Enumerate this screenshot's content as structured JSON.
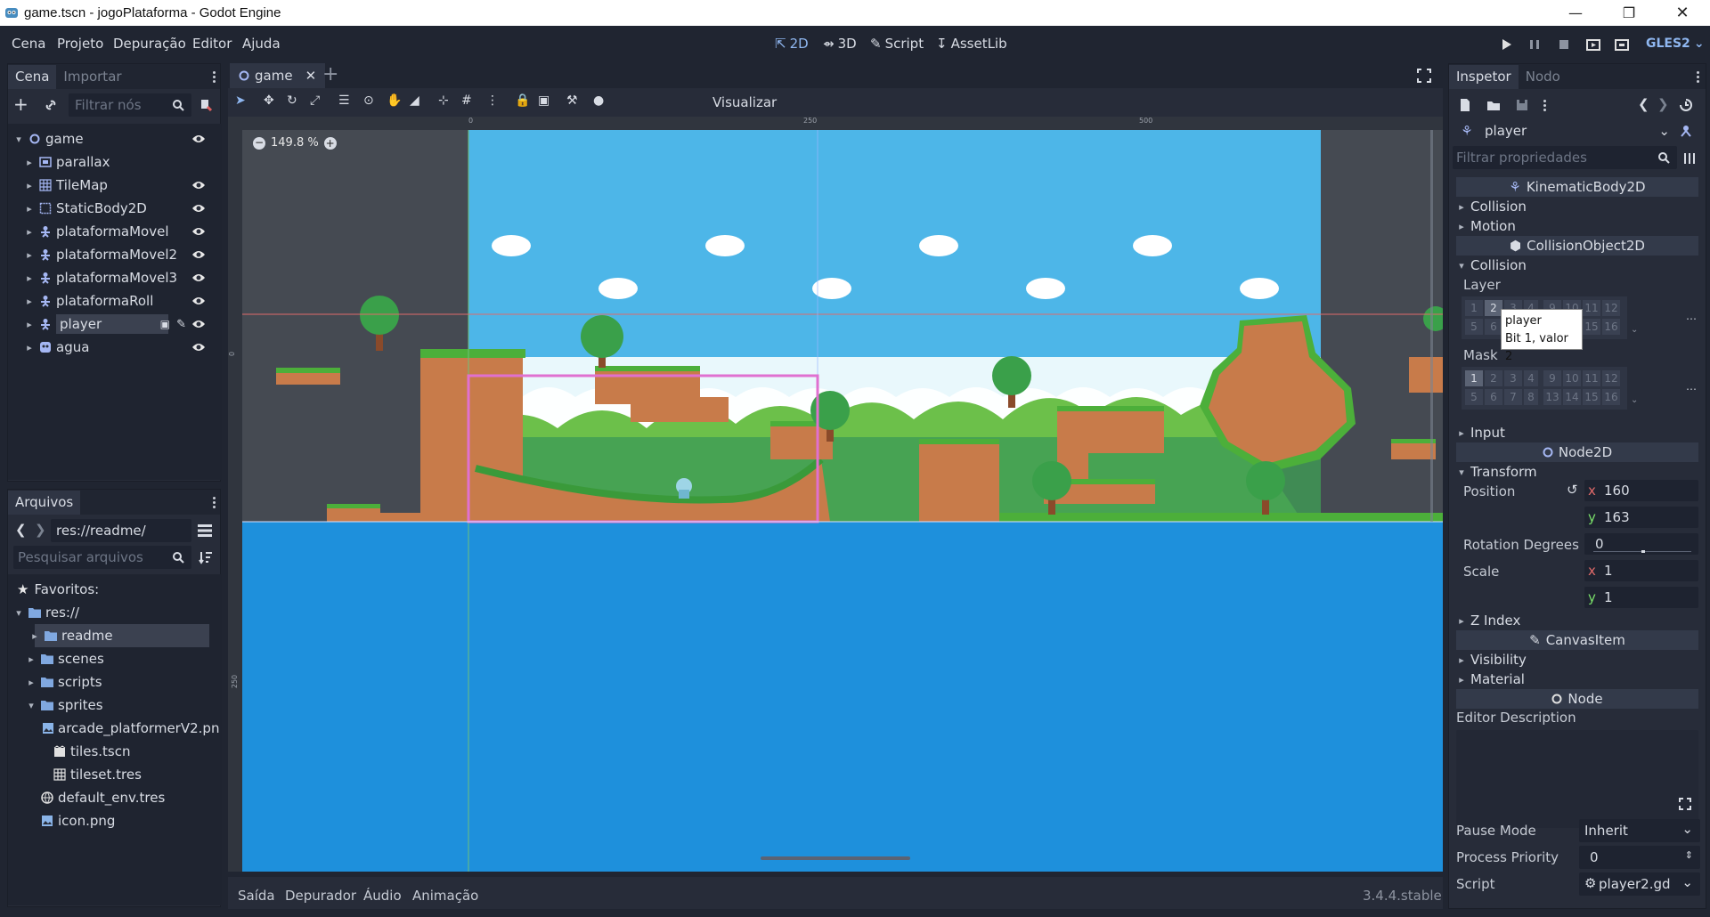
{
  "window": {
    "title": "game.tscn - jogoPlataforma - Godot Engine"
  },
  "menu": {
    "items": [
      "Cena",
      "Projeto",
      "Depuração",
      "Editor",
      "Ajuda"
    ]
  },
  "modes": {
    "mode_2d": "2D",
    "mode_3d": "3D",
    "script": "Script",
    "assetlib": "AssetLib"
  },
  "renderer": "GLES2",
  "scene_dock": {
    "tabs": [
      "Cena",
      "Importar"
    ],
    "filter_placeholder": "Filtrar nós",
    "nodes": [
      {
        "name": "game",
        "icon": "node2d-circle-icon",
        "level": 0,
        "expanded": true,
        "visible_eye": true
      },
      {
        "name": "parallax",
        "icon": "parallax-icon",
        "level": 1,
        "visible_eye": false
      },
      {
        "name": "TileMap",
        "icon": "tilemap-icon",
        "level": 1,
        "visible_eye": true
      },
      {
        "name": "StaticBody2D",
        "icon": "staticbody-icon",
        "level": 1,
        "visible_eye": true
      },
      {
        "name": "plataformaMovel",
        "icon": "kinematic-icon",
        "level": 1,
        "visible_eye": true
      },
      {
        "name": "plataformaMovel2",
        "icon": "kinematic-icon",
        "level": 1,
        "visible_eye": true
      },
      {
        "name": "plataformaMovel3",
        "icon": "kinematic-icon",
        "level": 1,
        "visible_eye": true
      },
      {
        "name": "plataformaRoll",
        "icon": "kinematic-icon",
        "level": 1,
        "visible_eye": true
      },
      {
        "name": "player",
        "icon": "kinematic-icon",
        "level": 1,
        "visible_eye": true,
        "selected": true
      },
      {
        "name": "agua",
        "icon": "area-icon",
        "level": 1,
        "visible_eye": true
      }
    ]
  },
  "filesystem_dock": {
    "title": "Arquivos",
    "path": "res://readme/",
    "search_placeholder": "Pesquisar arquivos",
    "favorites_label": "Favoritos:",
    "entries": [
      {
        "name": "res://",
        "level": 0,
        "kind": "folder"
      },
      {
        "name": "readme",
        "level": 1,
        "kind": "folder",
        "selected": true
      },
      {
        "name": "scenes",
        "level": 1,
        "kind": "folder"
      },
      {
        "name": "scripts",
        "level": 1,
        "kind": "folder"
      },
      {
        "name": "sprites",
        "level": 1,
        "kind": "folder"
      },
      {
        "name": "arcade_platformerV2.pn",
        "level": 2,
        "kind": "image"
      },
      {
        "name": "tiles.tscn",
        "level": 2,
        "kind": "scene"
      },
      {
        "name": "tileset.tres",
        "level": 2,
        "kind": "resource"
      },
      {
        "name": "default_env.tres",
        "level": 1,
        "kind": "env"
      },
      {
        "name": "icon.png",
        "level": 1,
        "kind": "image"
      }
    ]
  },
  "editor": {
    "scene_tab": "game",
    "view_button": "Visualizar",
    "zoom": "149.8 %",
    "ruler_ticks": [
      "0",
      "250",
      "500"
    ],
    "vruler_ticks": [
      "0",
      "250"
    ]
  },
  "bottom_panel": {
    "tabs": [
      "Saída",
      "Depurador",
      "Áudio",
      "Animação"
    ],
    "version": "3.4.4.stable"
  },
  "inspector": {
    "tabs": [
      "Inspetor",
      "Nodo"
    ],
    "object_name": "player",
    "filter_placeholder": "Filtrar propriedades",
    "class_kinematic": "KinematicBody2D",
    "kinematic_sections": [
      "Collision",
      "Motion"
    ],
    "class_collision_object": "CollisionObject2D",
    "collision_section": "Collision",
    "layer_label": "Layer",
    "mask_label": "Mask",
    "layer_bits": [
      "1",
      "2",
      "3",
      "4",
      "9",
      "10",
      "11",
      "12",
      "5",
      "6",
      "7",
      "8",
      "13",
      "14",
      "15",
      "16"
    ],
    "mask_bits": [
      "1",
      "2",
      "3",
      "4",
      "9",
      "10",
      "11",
      "12",
      "5",
      "6",
      "7",
      "8",
      "13",
      "14",
      "15",
      "16"
    ],
    "tooltip_title": "player",
    "tooltip_text": "Bit 1, valor 2",
    "input_section": "Input",
    "class_node2d": "Node2D",
    "transform_section": "Transform",
    "position_label": "Position",
    "position_x": "160",
    "position_y": "163",
    "rotation_label": "Rotation Degrees",
    "rotation_value": "0",
    "scale_label": "Scale",
    "scale_x": "1",
    "scale_y": "1",
    "axis_x": "x",
    "axis_y": "y",
    "z_index_section": "Z Index",
    "class_canvasitem": "CanvasItem",
    "canvas_sections": [
      "Visibility",
      "Material"
    ],
    "class_node": "Node",
    "editor_description_label": "Editor Description",
    "pause_mode_label": "Pause Mode",
    "pause_mode_value": "Inherit",
    "process_priority_label": "Process Priority",
    "process_priority_value": "0",
    "script_label": "Script",
    "script_value": "player2.gd"
  },
  "colors": {
    "accent": "#8fb7f0",
    "panel": "#272c39",
    "background": "#202531",
    "sky": "#4db6e8",
    "water": "#1e90dc"
  }
}
